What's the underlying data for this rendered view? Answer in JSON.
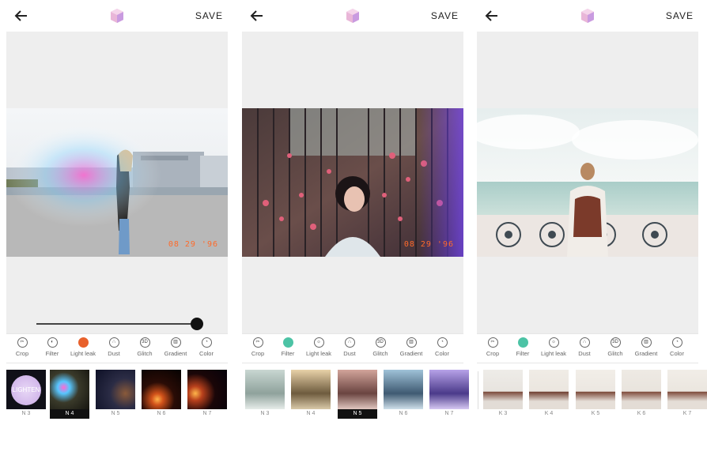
{
  "screens": [
    {
      "save_label": "SAVE",
      "date_stamp": "08 29 '96",
      "slider_value": 0.98,
      "tools": [
        {
          "label": "Crop",
          "icon": "crop-icon"
        },
        {
          "label": "Filter",
          "icon": "filter-icon"
        },
        {
          "label": "Light leak",
          "icon": "light-leak-icon"
        },
        {
          "label": "Dust",
          "icon": "dust-icon"
        },
        {
          "label": "Glitch",
          "icon": "3d-glitch-icon"
        },
        {
          "label": "Gradient",
          "icon": "gradient-icon"
        },
        {
          "label": "Color",
          "icon": "color-icon"
        }
      ],
      "active_tool": "Light leak",
      "thumb_overlay": "LIGHTEN",
      "thumbs": [
        "N 3",
        "N 4",
        "N 5",
        "N 6",
        "N 7"
      ],
      "selected_thumb": "N 4"
    },
    {
      "save_label": "SAVE",
      "date_stamp": "08 29 '96",
      "tools": [
        {
          "label": "Crop",
          "icon": "crop-icon"
        },
        {
          "label": "Filter",
          "icon": "filter-icon"
        },
        {
          "label": "Light leak",
          "icon": "light-leak-icon"
        },
        {
          "label": "Dust",
          "icon": "dust-icon"
        },
        {
          "label": "Glitch",
          "icon": "3d-glitch-icon"
        },
        {
          "label": "Gradient",
          "icon": "gradient-icon"
        },
        {
          "label": "Color",
          "icon": "color-icon"
        }
      ],
      "active_tool": "Filter",
      "thumbs": [
        "N 3",
        "N 4",
        "N 5",
        "N 6",
        "N 7"
      ],
      "selected_thumb": "N 5"
    },
    {
      "save_label": "SAVE",
      "tools": [
        {
          "label": "Crop",
          "icon": "crop-icon"
        },
        {
          "label": "Filter",
          "icon": "filter-icon"
        },
        {
          "label": "Light leak",
          "icon": "light-leak-icon"
        },
        {
          "label": "Dust",
          "icon": "dust-icon"
        },
        {
          "label": "Glitch",
          "icon": "3d-glitch-icon"
        },
        {
          "label": "Gradient",
          "icon": "gradient-icon"
        },
        {
          "label": "Color",
          "icon": "color-icon"
        }
      ],
      "active_tool": "Filter",
      "thumbs": [
        "K 3",
        "K 4",
        "K 5",
        "K 6",
        "K 7"
      ]
    }
  ],
  "colors": {
    "accent_orange": "#e8612c",
    "accent_teal": "#4cc3a5",
    "date_stamp": "#ff6a2a"
  }
}
